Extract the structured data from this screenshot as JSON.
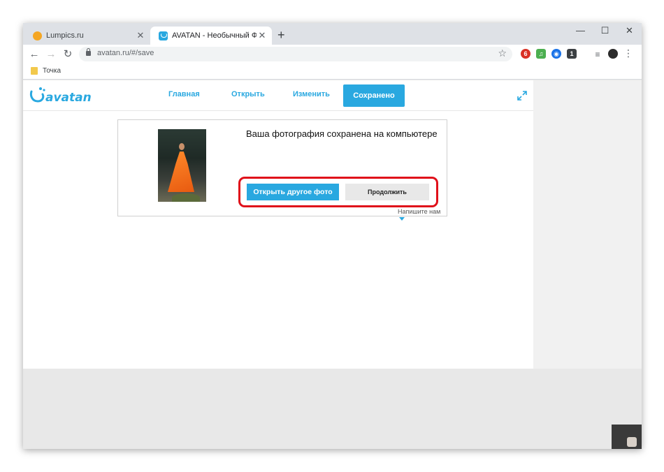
{
  "browser": {
    "tabs": [
      {
        "title": "Lumpics.ru",
        "active": false
      },
      {
        "title": "AVATAN - Необычный Фоторед",
        "active": true
      }
    ],
    "new_tab": "+",
    "window_controls": {
      "minimize": "—",
      "maximize": "☐",
      "close": "✕"
    },
    "url": "avatan.ru/#/save",
    "bookmark": "Точка",
    "extension_badges": {
      "opera": "6",
      "blue": "1"
    }
  },
  "site": {
    "logo_text": "avatan",
    "nav": {
      "home": "Главная",
      "open": "Открыть",
      "edit": "Изменить",
      "saved": "Сохранено"
    }
  },
  "result": {
    "message": "Ваша фотография сохранена  на компьютере",
    "open_another_label": "Открыть другое фото",
    "continue_label": "Продолжить",
    "feedback_label": "Напишите нам"
  },
  "colors": {
    "accent": "#29a8e0",
    "highlight": "#e0101a"
  }
}
